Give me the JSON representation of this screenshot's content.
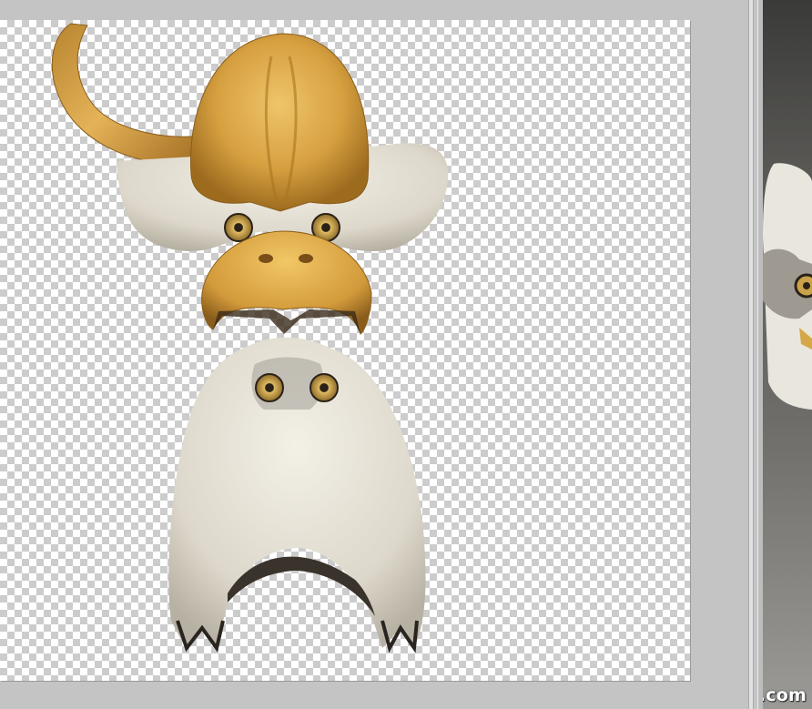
{
  "workspace": {
    "background_color": "#c4c4c4"
  },
  "canvas": {
    "layer_contents": "eagle-head-parts-composite",
    "transparency_grid": true
  },
  "reference_photo": {
    "subject": "eagle-photo-crop"
  },
  "watermark": {
    "text": "pxleyes.com"
  },
  "colors": {
    "helmet_gold": "#d6a34a",
    "feather_white": "#e8e4d8",
    "eye_iris": "#c9a24a",
    "feather_dark": "#3a332c"
  }
}
